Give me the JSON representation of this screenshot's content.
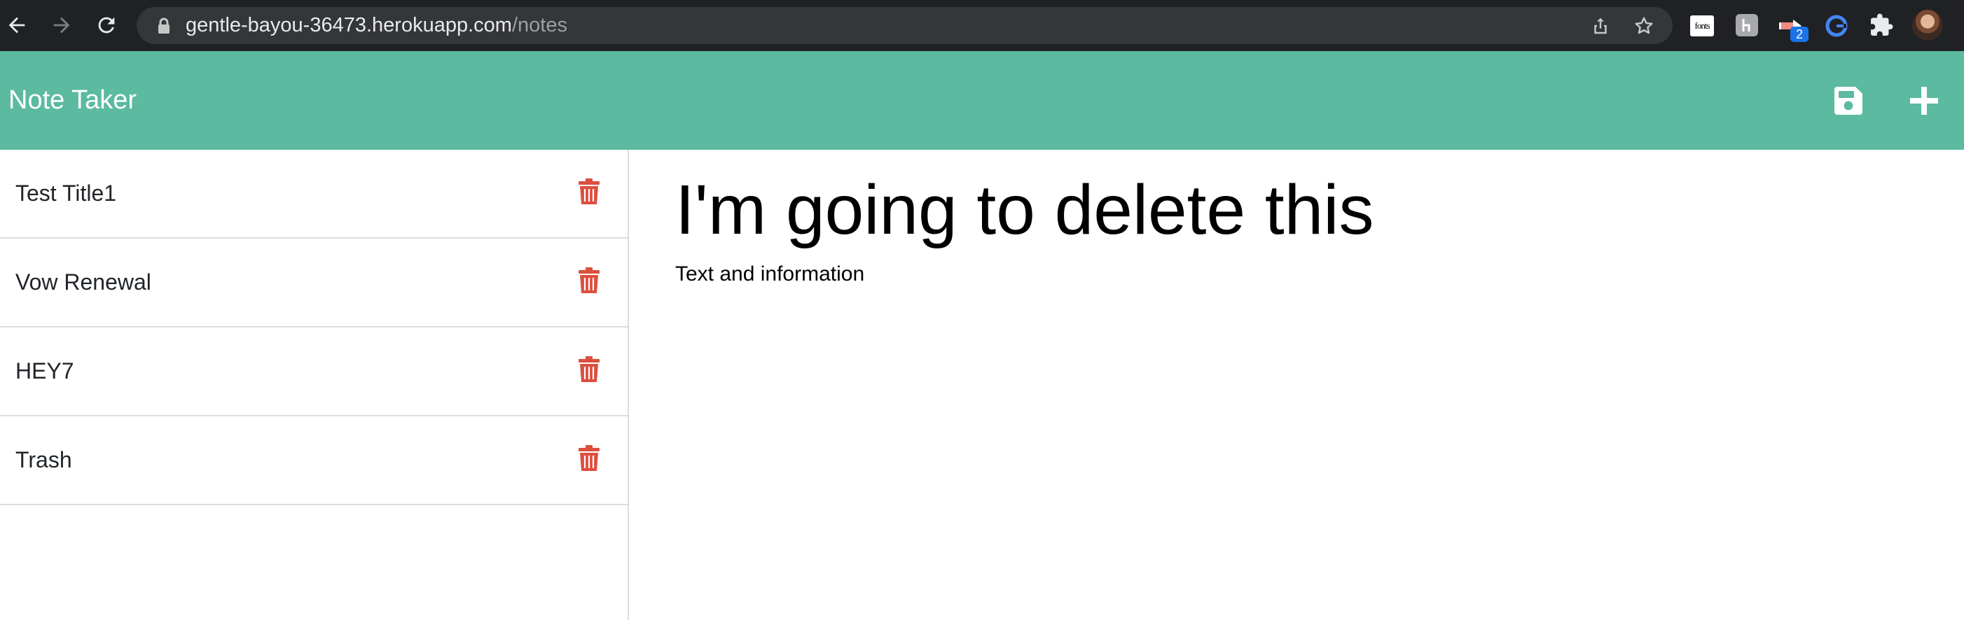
{
  "browser": {
    "url_host": "gentle-bayou-36473.herokuapp.com",
    "url_path": "/notes",
    "extensions": [
      {
        "name": "fonts-extension",
        "label": "fonts"
      },
      {
        "name": "grey-extension"
      },
      {
        "name": "badge-extension",
        "badge": "2"
      },
      {
        "name": "g-extension"
      },
      {
        "name": "extensions-puzzle"
      }
    ]
  },
  "app": {
    "brand": "Note Taker",
    "accent_color": "#5bba9f",
    "delete_color": "#dc4f3e",
    "actions": [
      {
        "name": "save-icon"
      },
      {
        "name": "plus-icon"
      }
    ]
  },
  "notes": [
    {
      "title": "Test Title1"
    },
    {
      "title": "Vow Renewal"
    },
    {
      "title": "HEY7"
    },
    {
      "title": "Trash"
    }
  ],
  "active_note": {
    "title": "I'm going to delete this",
    "text": "Text and information"
  }
}
